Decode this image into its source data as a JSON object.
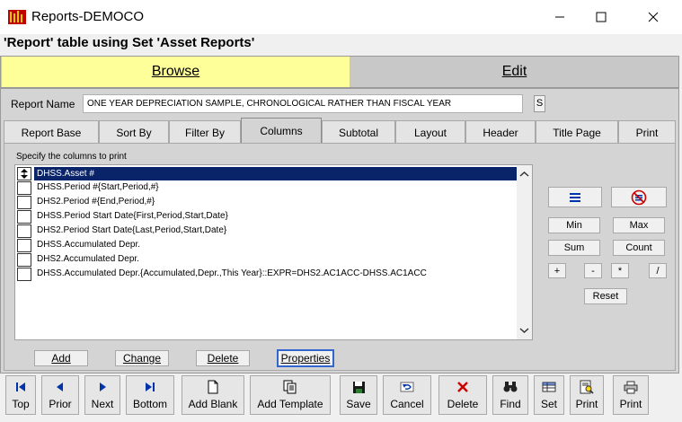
{
  "window": {
    "title": "Reports-DEMOCO",
    "minimize_glyph": "—",
    "maximize_glyph": "☐",
    "close_glyph": "✕"
  },
  "subtitle": "'Report' table using Set 'Asset Reports'",
  "modes": {
    "browse": "Browse",
    "edit": "Edit"
  },
  "report_name": {
    "label": "Report Name",
    "value": "ONE YEAR DEPRECIATION SAMPLE, CHRONOLOGICAL RATHER THAN FISCAL YEAR",
    "s_button": "S"
  },
  "tabs": [
    "Report Base",
    "Sort By",
    "Filter By",
    "Columns",
    "Subtotal",
    "Layout",
    "Header",
    "Title Page",
    "Print"
  ],
  "active_tab": "Columns",
  "columns": {
    "hint": "Specify the columns to print",
    "items": [
      "DHSS.Asset #",
      "DHSS.Period #{Start,Period,#}",
      "DHS2.Period #{End,Period,#}",
      "DHSS.Period Start Date{First,Period,Start,Date}",
      "DHS2.Period Start Date{Last,Period,Start,Date}",
      "DHSS.Accumulated Depr.",
      "DHS2.Accumulated Depr.",
      "DHSS.Accumulated Depr.{Accumulated,Depr.,This Year}::EXPR=DHS2.AC1ACC-DHSS.AC1ACC"
    ],
    "selected_index": 0
  },
  "functions": {
    "min": "Min",
    "max": "Max",
    "sum": "Sum",
    "count": "Count",
    "plus": "+",
    "minus": "-",
    "multiply": "*",
    "divide": "/",
    "reset": "Reset"
  },
  "list_buttons": {
    "add": "Add",
    "change": "Change",
    "delete": "Delete",
    "properties": "Properties"
  },
  "toolbar": [
    {
      "name": "top",
      "label": "Top",
      "icon": "first-icon"
    },
    {
      "name": "prior",
      "label": "Prior",
      "icon": "prev-icon"
    },
    {
      "name": "next",
      "label": "Next",
      "icon": "next-icon"
    },
    {
      "name": "bottom",
      "label": "Bottom",
      "icon": "last-icon"
    },
    {
      "name": "add-blank",
      "label": "Add Blank",
      "icon": "new-doc-icon"
    },
    {
      "name": "add-template",
      "label": "Add Template",
      "icon": "copy-doc-icon"
    },
    {
      "name": "save",
      "label": "Save",
      "icon": "save-icon"
    },
    {
      "name": "cancel",
      "label": "Cancel",
      "icon": "undo-icon"
    },
    {
      "name": "delete",
      "label": "Delete",
      "icon": "delete-x-icon"
    },
    {
      "name": "find",
      "label": "Find",
      "icon": "binoculars-icon"
    },
    {
      "name": "set",
      "label": "Set",
      "icon": "table-set-icon"
    },
    {
      "name": "print-preview",
      "label": "Print",
      "icon": "print-preview-icon"
    },
    {
      "name": "print",
      "label": "Print",
      "icon": "printer-icon"
    }
  ],
  "colors": {
    "browse_bg": "#ffff99",
    "selection": "#0a246a",
    "accent_blue": "#0033aa",
    "delete_red": "#cc0000"
  }
}
